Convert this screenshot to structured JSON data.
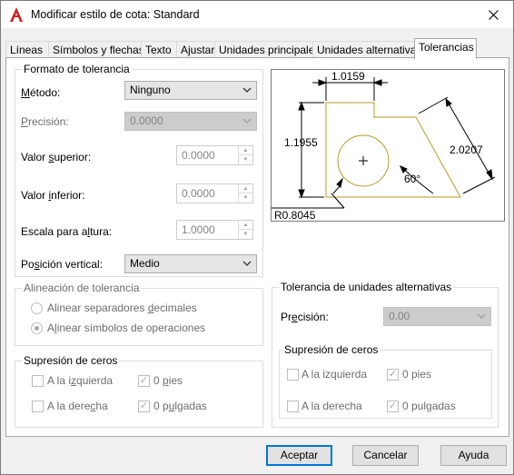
{
  "window": {
    "title": "Modificar estilo de cota: Standard"
  },
  "tabs": [
    {
      "label": "Líneas"
    },
    {
      "label": "Símbolos y flechas"
    },
    {
      "label": "Texto"
    },
    {
      "label": "Ajustar"
    },
    {
      "label": "Unidades principales"
    },
    {
      "label": "Unidades alternativas"
    },
    {
      "label": "Tolerancias",
      "active": true
    }
  ],
  "tolerance_format": {
    "title": "Formato de tolerancia",
    "method_label": "Método:",
    "method_value": "Ninguno",
    "precision_label": "Precisión:",
    "precision_value": "0.0000",
    "upper_label": "Valor superior:",
    "upper_value": "0.0000",
    "lower_label": "Valor inferior:",
    "lower_value": "0.0000",
    "height_label": "Escala para altura:",
    "height_value": "1.0000",
    "vertical_label": "Posición vertical:",
    "vertical_value": "Medio"
  },
  "alignment": {
    "title": "Alineación de tolerancia",
    "opt1": "Alinear separadores decimales",
    "opt2": "Alinear símbolos de operaciones"
  },
  "zero_suppression_left": {
    "title": "Supresión de ceros",
    "leading": "A la izquierda",
    "trailing": "A la derecha",
    "feet": "0 pies",
    "inches": "0 pulgadas"
  },
  "alt_units": {
    "title": "Tolerancia de unidades alternativas",
    "precision_label": "Precisión:",
    "precision_value": "0.00",
    "zero_title": "Supresión de ceros",
    "leading": "A la izquierda",
    "trailing": "A la derecha",
    "feet": "0 pies",
    "inches": "0 pulgadas"
  },
  "preview": {
    "dim_top": "1.0159",
    "dim_left": "1.1955",
    "dim_right": "2.0207",
    "dim_angle": "60°",
    "dim_radius": "R0.8045"
  },
  "buttons": {
    "ok": "Aceptar",
    "cancel": "Cancelar",
    "help": "Ayuda"
  },
  "colors": {
    "accent": "#0078d7",
    "drawing": "#b59a2a",
    "autocad_red": "#d01f1f"
  }
}
